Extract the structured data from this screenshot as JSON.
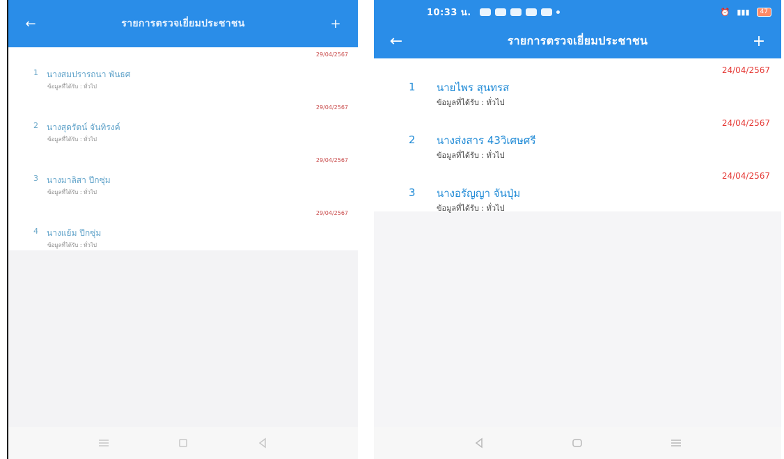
{
  "left": {
    "title": "รายการตรวจเยี่ยมประชาชน",
    "icons": {
      "back": "arrow-left-icon",
      "add": "plus-icon"
    },
    "items": [
      {
        "num": "1",
        "name": "นางสมปรารถนา พันธศ",
        "sub": "ข้อมูลที่ได้รับ : ทั่วไป",
        "date": "29/04/2567"
      },
      {
        "num": "2",
        "name": "นางสุดรัตน์ จันทิรงค์",
        "sub": "ข้อมูลที่ได้รับ : ทั่วไป",
        "date": "29/04/2567"
      },
      {
        "num": "3",
        "name": "นางมาลิสา ปีกซุ่ม",
        "sub": "ข้อมูลที่ได้รับ : ทั่วไป",
        "date": "29/04/2567"
      },
      {
        "num": "4",
        "name": "นางแย้ม ปีกซุ่ม",
        "sub": "ข้อมูลที่ได้รับ : ทั่วไป",
        "date": "29/04/2567"
      }
    ]
  },
  "right": {
    "status": {
      "time": "10:33 น.",
      "battery": "47"
    },
    "title": "รายการตรวจเยี่ยมประชาชน",
    "icons": {
      "back": "arrow-left-icon",
      "add": "plus-icon"
    },
    "items": [
      {
        "num": "1",
        "name": "นายไพร สุนทรส",
        "sub": "ข้อมูลที่ได้รับ : ทั่วไป",
        "date": "24/04/2567"
      },
      {
        "num": "2",
        "name": "นางส่งสาร 43วิเศษศรี",
        "sub": "ข้อมูลที่ได้รับ : ทั่วไป",
        "date": "24/04/2567"
      },
      {
        "num": "3",
        "name": "นางอรัญญา จันปุ่ม",
        "sub": "ข้อมูลที่ได้รับ : ทั่วไป",
        "date": "24/04/2567"
      }
    ]
  },
  "colors": {
    "primary": "#2a8de8",
    "date": "#e53935",
    "name": "#1f8ad6"
  }
}
